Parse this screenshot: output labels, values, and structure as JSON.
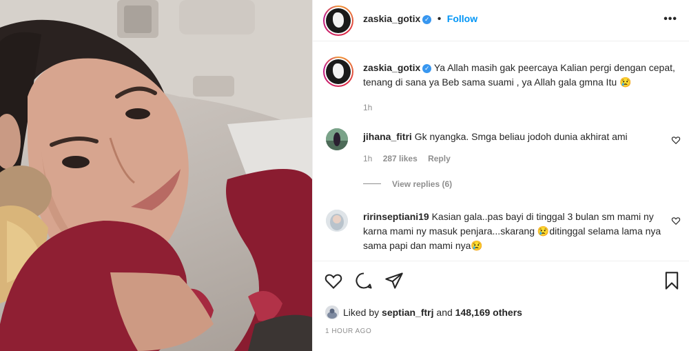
{
  "post": {
    "author": "zaskia_gotix",
    "follow_label": "Follow",
    "more_label": "•••",
    "verified_mark": "✓"
  },
  "caption": {
    "username": "zaskia_gotix",
    "text": "Ya Allah masih gak peercaya Kalian pergi dengan cepat, tenang di sana ya Beb sama suami , ya Allah gala gmna Itu 😢",
    "time": "1h"
  },
  "comments": [
    {
      "username": "jihana_fitri",
      "text": "Gk nyangka. Smga beliau jodoh dunia akhirat ami",
      "time": "1h",
      "likes": "287 likes",
      "reply_label": "Reply",
      "view_replies": "View replies (6)"
    },
    {
      "username": "ririnseptiani19",
      "text": "Kasian gala..pas bayi di tinggal 3 bulan sm mami ny karna mami ny masuk penjara...skarang 😢ditinggal selama lama nya sama papi dan mami nya😢"
    }
  ],
  "actions": {
    "icons": [
      "heart-icon",
      "comment-icon",
      "share-icon",
      "bookmark-icon"
    ]
  },
  "likes": {
    "prefix": "Liked by",
    "user": "septian_ftrj",
    "connector": "and",
    "others": "148,169 others"
  },
  "timestamp": "1 HOUR AGO",
  "colors": {
    "accent": "#0095f6",
    "verified": "#3897f0",
    "muted": "#8e8e8e"
  }
}
